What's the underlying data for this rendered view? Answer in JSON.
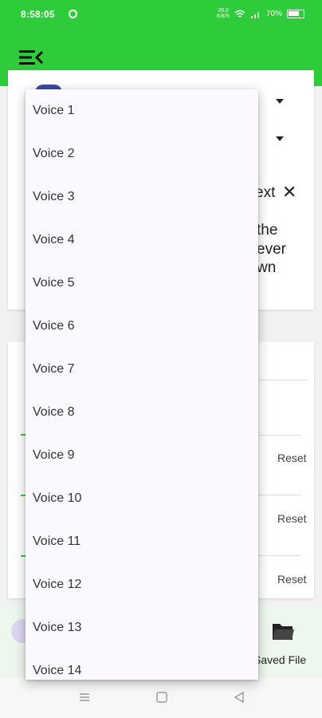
{
  "status_bar": {
    "time": "8:58:05",
    "network_speed": "28.0",
    "network_unit": "KB/S",
    "battery": "70%"
  },
  "icons": {
    "menu": "menu-collapse-icon",
    "close": "close-icon",
    "folder": "folder-icon",
    "home": "square-home-icon",
    "back": "triangle-back-icon",
    "recents": "lines-recents-icon"
  },
  "colors": {
    "accent": "#2ecc3a",
    "popup_bg": "#fbf9fd"
  },
  "background_text": {
    "ext": "ext",
    "the": "the",
    "ever": "ever",
    "wn": "wn"
  },
  "resets": [
    "Reset",
    "Reset",
    "Reset"
  ],
  "bottom_nav": {
    "saved_file": "Saved File"
  },
  "voice_dropdown": {
    "items": [
      "Voice 1",
      "Voice 2",
      "Voice 3",
      "Voice 4",
      "Voice 5",
      "Voice 6",
      "Voice 7",
      "Voice 8",
      "Voice 9",
      "Voice 10",
      "Voice 11",
      "Voice 12",
      "Voice 13",
      "Voice 14"
    ]
  }
}
